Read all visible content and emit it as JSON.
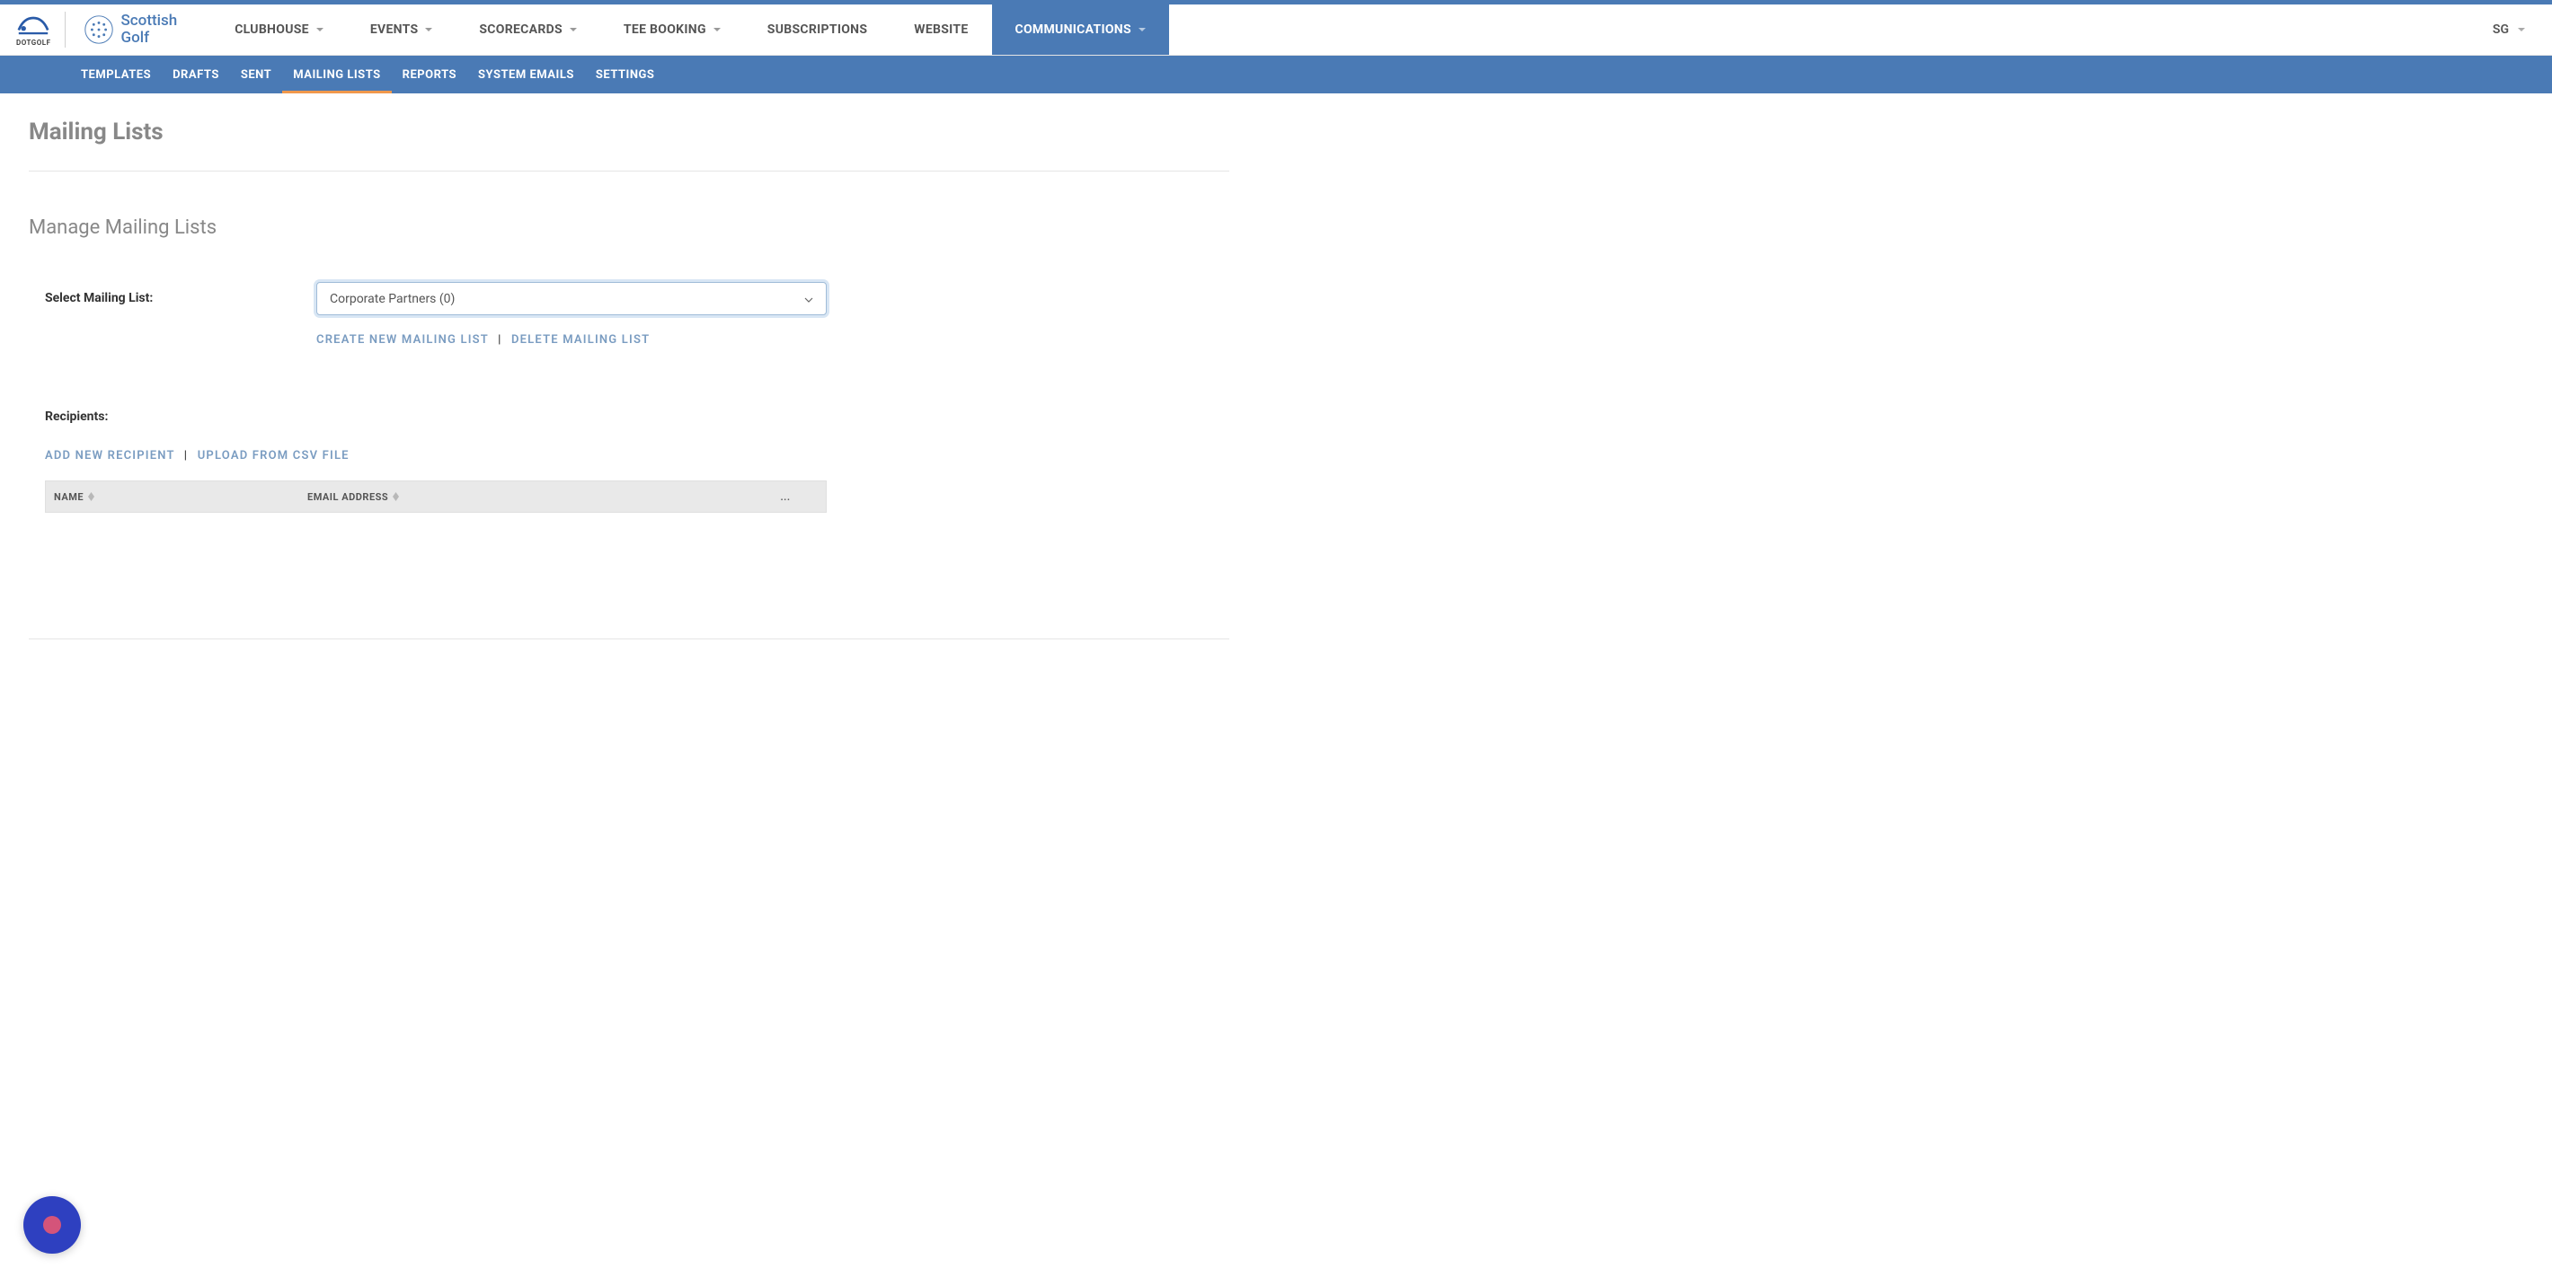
{
  "brand": {
    "dotgolf": "DOTGOLF",
    "scottish_line1": "Scottish",
    "scottish_line2": "Golf"
  },
  "nav": {
    "items": [
      {
        "label": "CLUBHOUSE",
        "dropdown": true
      },
      {
        "label": "EVENTS",
        "dropdown": true
      },
      {
        "label": "SCORECARDS",
        "dropdown": true
      },
      {
        "label": "TEE BOOKING",
        "dropdown": true
      },
      {
        "label": "SUBSCRIPTIONS",
        "dropdown": false
      },
      {
        "label": "WEBSITE",
        "dropdown": false
      },
      {
        "label": "COMMUNICATIONS",
        "dropdown": true
      }
    ],
    "active_index": 6
  },
  "user": {
    "initials": "SG"
  },
  "subnav": {
    "items": [
      "TEMPLATES",
      "DRAFTS",
      "SENT",
      "MAILING LISTS",
      "REPORTS",
      "SYSTEM EMAILS",
      "SETTINGS"
    ],
    "active_index": 3
  },
  "page": {
    "title": "Mailing Lists",
    "section_title": "Manage Mailing Lists",
    "select_label": "Select Mailing List:",
    "select_value": "Corporate Partners (0)",
    "create_link": "CREATE NEW MAILING LIST",
    "delete_link": "DELETE MAILING LIST",
    "recipients_label": "Recipients:",
    "add_recipient": "ADD NEW RECIPIENT",
    "upload_csv": "UPLOAD FROM CSV FILE",
    "table": {
      "col_name": "NAME",
      "col_email": "EMAIL ADDRESS",
      "col_actions": "..."
    }
  }
}
